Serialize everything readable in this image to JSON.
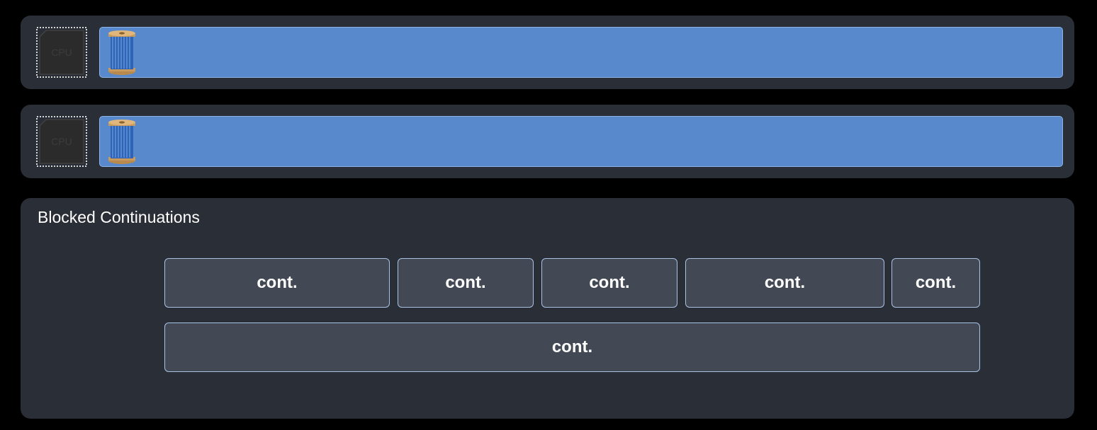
{
  "cpus": [
    {
      "chip_label": "CPU",
      "icon": "cpu-chip-icon",
      "thread_icon": "thread-spool-icon"
    },
    {
      "chip_label": "CPU",
      "icon": "cpu-chip-icon",
      "thread_icon": "thread-spool-icon"
    }
  ],
  "blocked": {
    "title": "Blocked Continuations",
    "items": [
      "cont.",
      "cont.",
      "cont.",
      "cont.",
      "cont.",
      "cont."
    ]
  },
  "colors": {
    "background": "#000000",
    "panel": "#2a2e37",
    "thread_bar": "#5889cc",
    "continuation_fill": "#424955",
    "continuation_border": "#a9c2e4"
  }
}
